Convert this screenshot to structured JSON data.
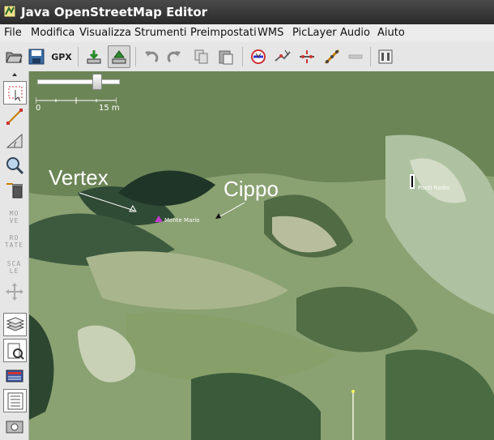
{
  "window": {
    "title": "Java OpenStreetMap Editor"
  },
  "menu": [
    "File",
    "Modifica",
    "Visualizza",
    "Strumenti",
    "Preimpostati",
    "WMS",
    "PicLayer",
    "Audio",
    "Aiuto"
  ],
  "toolbar": {
    "gpx_label": "GPX",
    "icons": [
      "open-icon",
      "save-icon",
      "gpx-export-icon",
      "download-icon",
      "upload-icon",
      "undo-icon",
      "redo-icon",
      "copy-icon",
      "paste-icon",
      "validate-icon",
      "split-way-icon",
      "combine-way-icon",
      "align-line-icon",
      "disabled-tool-icon",
      "preferences-icon"
    ]
  },
  "sidebar": {
    "move_label": [
      "MO",
      "VE"
    ],
    "rotate_label": [
      "RO",
      "TATE"
    ],
    "scale_label": [
      "SCA",
      "LE"
    ],
    "icons": [
      "select-icon",
      "draw-icon",
      "measure-icon",
      "zoom-icon",
      "delete-icon",
      "move-icon",
      "rotate-icon",
      "scale-icon",
      "wms-move-icon",
      "layers-icon",
      "properties-icon",
      "history-icon",
      "list-icon",
      "photo-icon"
    ]
  },
  "map": {
    "scale_start": "0",
    "scale_end": "15 m",
    "annotations": {
      "vertex": "Vertex",
      "cippo": "Cippo"
    },
    "poi": {
      "monte_mario": "Monte Mario",
      "radio": "Ponti Radio"
    },
    "colors": {
      "peak_marker": "#c03acd",
      "text": "#ffffff"
    }
  }
}
